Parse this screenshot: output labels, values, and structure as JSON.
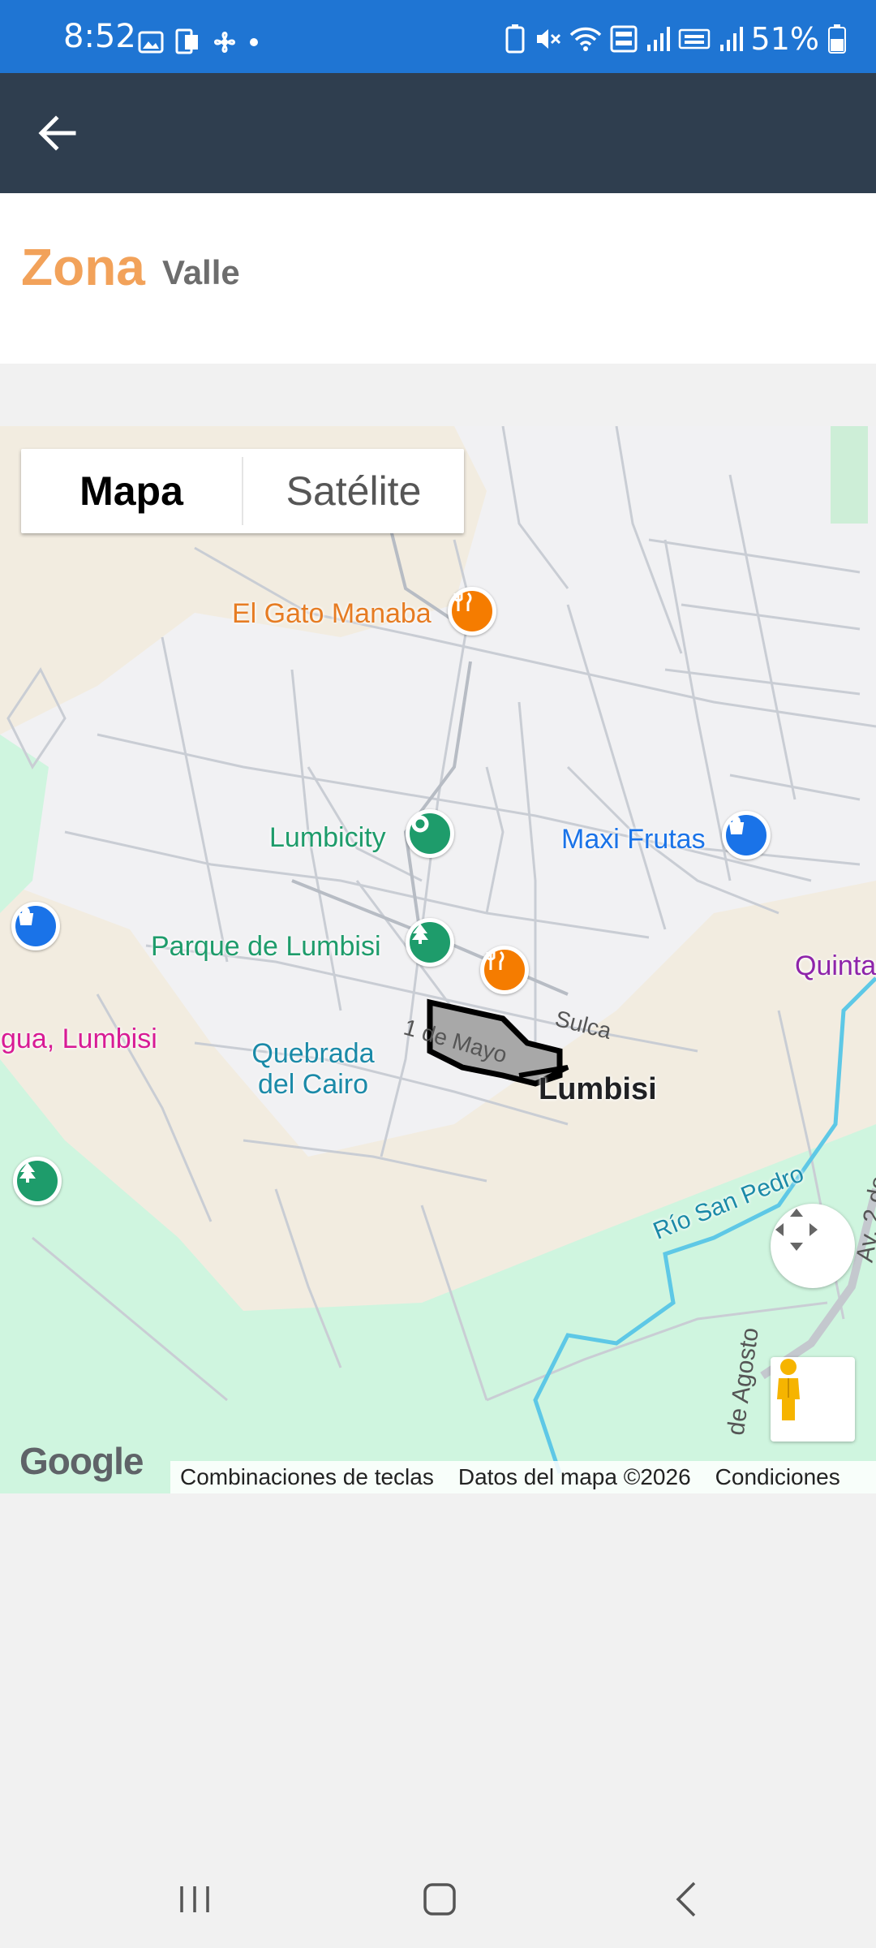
{
  "status_bar": {
    "time": "8:52",
    "battery_percent": "51%",
    "left_icons": [
      "image-icon",
      "device-icon",
      "fan-icon",
      "dot-icon"
    ],
    "right_icons": [
      "battery-saver-icon",
      "mute-icon",
      "wifi-icon",
      "volte-icon",
      "signal-icon",
      "wifi-calling-icon",
      "signal-icon"
    ]
  },
  "app_bar": {
    "back_icon": "arrow-left-icon"
  },
  "zone": {
    "title": "Zona",
    "subtitle": "Valle"
  },
  "map": {
    "type_control": {
      "options": [
        "Mapa",
        "Satélite"
      ],
      "selected": "Mapa"
    },
    "pois": [
      {
        "name": "El Gato Manaba",
        "kind": "restaurant-icon",
        "color": "#f57c00"
      },
      {
        "name": "Lumbicity",
        "kind": "place-icon",
        "color": "#1e9c6b"
      },
      {
        "name": "Maxi Frutas",
        "kind": "shopping-icon",
        "color": "#1a73e8"
      },
      {
        "name": "Parque de Lumbisi",
        "kind": "park-icon",
        "color": "#1e9c6b"
      },
      {
        "name": "Quebrada del Cairo",
        "kind": "water-label",
        "color": "#1b8aa8"
      },
      {
        "name": "Lumbisi",
        "kind": "town-label",
        "color": "#202124"
      },
      {
        "name": "gua, Lumbisi",
        "kind": "label",
        "color": "#d81b95"
      },
      {
        "name": "Quinta",
        "kind": "label",
        "color": "#8e24aa"
      },
      {
        "name": "Río San Pedro",
        "kind": "river-label",
        "color": "#1b8aa8"
      }
    ],
    "street_labels": [
      "Sulca",
      "1 de Mayo",
      "de Agosto",
      "Av. 2 de"
    ],
    "google_logo": "Google",
    "footer": [
      "Combinaciones de teclas",
      "Datos del mapa ©2026",
      "Condiciones"
    ],
    "colors": {
      "land": "#f1f1f3",
      "green": "#cff5df",
      "sand": "#f2ece0",
      "river": "#5ec8e6",
      "zone_fill": "#a8a8a8"
    }
  },
  "nav_bar": {
    "icons": [
      "recent-apps-icon",
      "home-icon",
      "back-icon"
    ]
  }
}
